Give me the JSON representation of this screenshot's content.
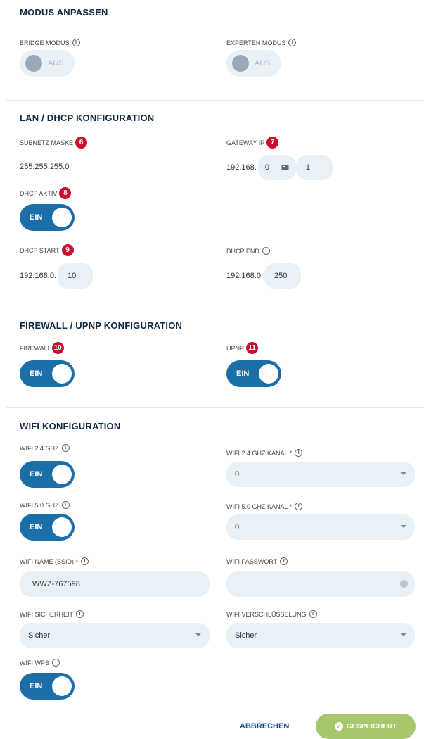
{
  "modus": {
    "title": "MODUS ANPASSEN",
    "bridge_label": "BRIDGE MODUS",
    "bridge_state": "AUS",
    "experten_label": "EXPERTEN MODUS",
    "experten_state": "AUS"
  },
  "lan": {
    "title": "LAN / DHCP KONFIGURATION",
    "subnet_label": "SUBNETZ MASKE",
    "subnet_badge": "6",
    "subnet_value": "255.255.255.0",
    "gateway_label": "GATEWAY IP",
    "gateway_badge": "7",
    "gateway_prefix": "192.168.",
    "gateway_octet3": "0",
    "gateway_octet4": "1",
    "dhcp_active_label": "DHCP AKTIV",
    "dhcp_active_badge": "8",
    "dhcp_active_state": "EIN",
    "dhcp_start_label": "DHCP START",
    "dhcp_start_badge": "9",
    "dhcp_start_prefix": "192.168.0.",
    "dhcp_start_value": "10",
    "dhcp_end_label": "DHCP END",
    "dhcp_end_prefix": "192.168.0.",
    "dhcp_end_value": "250"
  },
  "firewall": {
    "title": "FIREWALL / UPNP KONFIGURATION",
    "firewall_label": "FIREWALL",
    "firewall_badge": "10",
    "firewall_state": "EIN",
    "upnp_label": "UPNP",
    "upnp_badge": "11",
    "upnp_state": "EIN"
  },
  "wifi": {
    "title": "WIFI KONFIGURATION",
    "wifi24_label": "WIFI 2.4 GHZ",
    "wifi24_state": "EIN",
    "wifi24_channel_label": "WIFI 2.4 GHZ KANAL *",
    "wifi24_channel_value": "0",
    "wifi50_label": "WIFI 5.0 GHZ",
    "wifi50_state": "EIN",
    "wifi50_channel_label": "WIFI 5.0 GHZ KANAL *",
    "wifi50_channel_value": "0",
    "ssid_label": "WIFI NAME (SSID) *",
    "ssid_value": "WWZ-767598",
    "password_label": "WIFI PASSWORT",
    "password_value": "",
    "security_label": "WIFI SICHERHEIT",
    "security_value": "Sicher",
    "encryption_label": "WIFI VERSCHLÜSSELUNG",
    "encryption_value": "Sicher",
    "wps_label": "WIFI WPS",
    "wps_state": "EIN"
  },
  "footer": {
    "cancel_label": "ABBRECHEN",
    "save_label": "GESPEICHERT"
  },
  "icons": {
    "info": "info-icon",
    "check": "check-icon",
    "eye": "eye-icon",
    "caret": "chevron-down-icon",
    "card": "card-icon"
  },
  "colors": {
    "toggle_on": "#1b6ea8",
    "badge": "#c8102e",
    "save": "#a6c76c",
    "field_bg": "#e8f0f8"
  }
}
